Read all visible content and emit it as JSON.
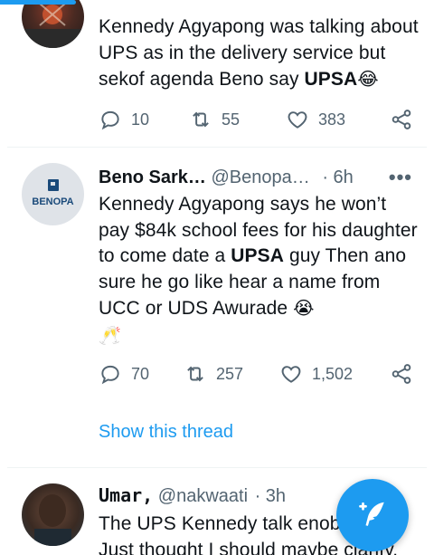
{
  "tweets": [
    {
      "text_pre": "Kennedy Agyapong was talking about UPS as in the delivery service but sekof agenda Beno say ",
      "text_bold": "UPSA",
      "text_emoji": "😂",
      "replies": "10",
      "retweets": "55",
      "likes": "383"
    },
    {
      "name": "Beno Sark…",
      "handle": "@Benopa…",
      "time": "· 6h",
      "avatar_text": "BENOPA",
      "text_pre": "Kennedy Agyapong says he won’t pay $84k school fees for his daughter to come date a ",
      "text_bold": "UPSA",
      "text_post": " guy Then ano sure he go like hear a name from UCC or UDS Awurade ",
      "text_emoji": "😭",
      "text_emoji2": "🥂",
      "replies": "70",
      "retweets": "257",
      "likes": "1,502",
      "show_thread": "Show this thread"
    },
    {
      "name": "Umar,",
      "handle": "@nakwaati",
      "time": "· 3h",
      "text_line1": "The UPS Kennedy talk enobe",
      "text_line2": "Just thought I should maybe clarify."
    }
  ],
  "colors": {
    "accent": "#1d9bf0",
    "muted": "#536471",
    "text": "#0f1419"
  },
  "icons": [
    "reply-icon",
    "retweet-icon",
    "like-icon",
    "share-icon",
    "more-icon",
    "compose-icon"
  ]
}
